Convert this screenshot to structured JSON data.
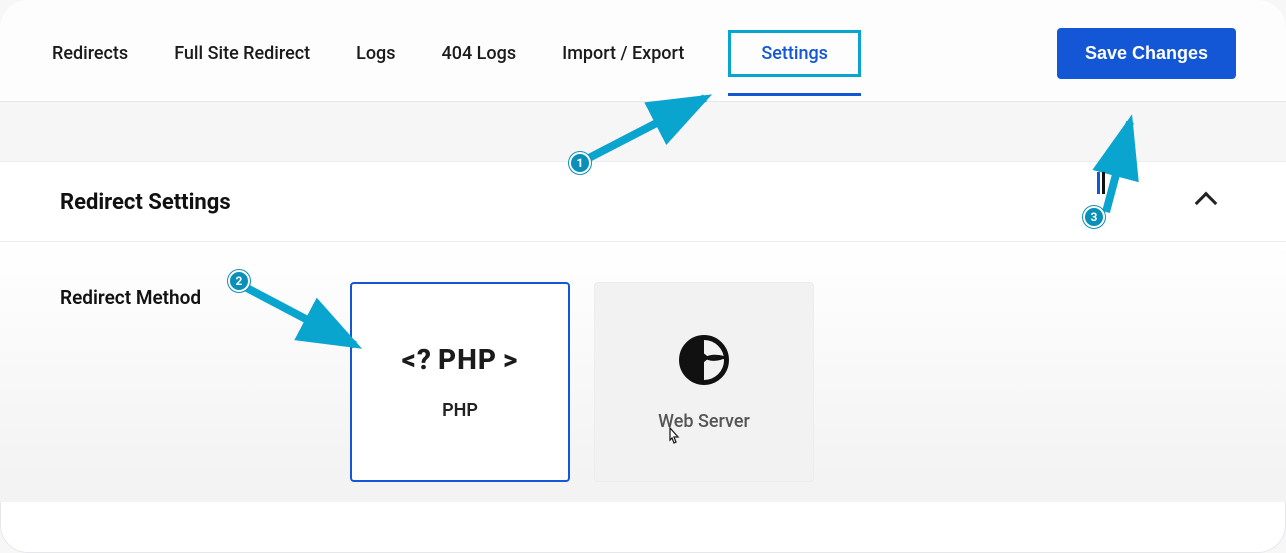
{
  "tabs": {
    "redirects": "Redirects",
    "full_site": "Full Site Redirect",
    "logs": "Logs",
    "logs404": "404 Logs",
    "import_export": "Import / Export",
    "settings": "Settings"
  },
  "actions": {
    "save": "Save Changes"
  },
  "panel": {
    "title": "Redirect Settings",
    "field_label": "Redirect Method",
    "options": {
      "php_icon_text": "<? PHP >",
      "php_label": "PHP",
      "webserver_label": "Web Server"
    }
  },
  "annotations": {
    "step1": "1",
    "step2": "2",
    "step3": "3"
  },
  "colors": {
    "accent": "#1357d6",
    "highlight_box": "#0aa5cf",
    "badge": "#0a8fb8"
  }
}
